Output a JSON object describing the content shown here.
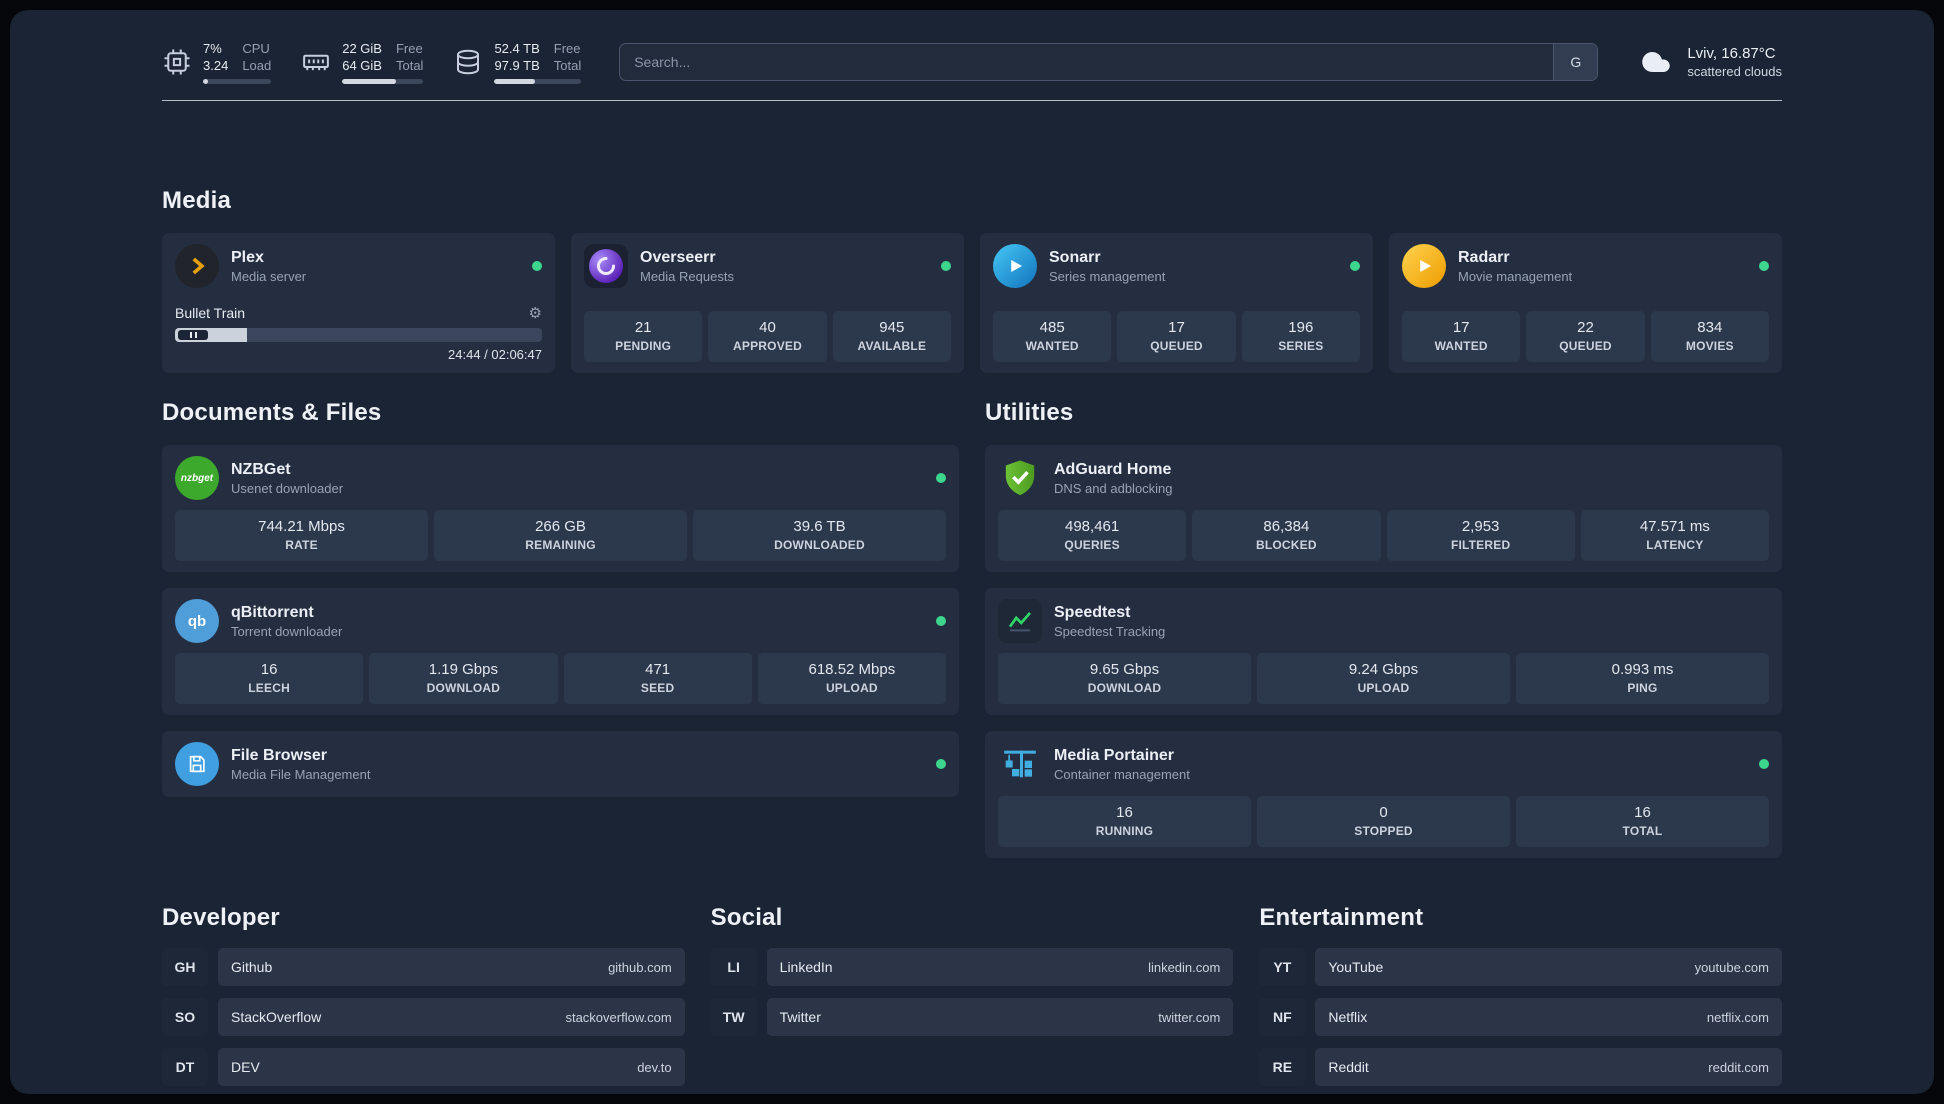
{
  "icons": {
    "gear": "⚙"
  },
  "colors": {
    "status_online": "#3dd68c",
    "accent_plex": "#e5a00d",
    "accent_sonarr": "#35c5f4",
    "accent_radarr": "#ffc230",
    "accent_overseerr": "#7c5cdb",
    "accent_nzbget": "#3ca92c",
    "accent_qbittorrent": "#4f9ed9",
    "accent_adguard": "#67b32e",
    "accent_speedtest": "#2fd566",
    "accent_portainer": "#41aee2",
    "accent_filebrowser": "#3f9fe0"
  },
  "header": {
    "cpu": {
      "value": "7%",
      "sub": "3.24",
      "label_top": "CPU",
      "label_bottom": "Load",
      "bar_percent": 7
    },
    "ram": {
      "value": "22 GiB",
      "sub": "64 GiB",
      "label_top": "Free",
      "label_bottom": "Total",
      "bar_percent": 66
    },
    "disk": {
      "value": "52.4 TB",
      "sub": "97.9 TB",
      "label_top": "Free",
      "label_bottom": "Total",
      "bar_percent": 47
    },
    "search": {
      "placeholder": "Search...",
      "engine_label": "G"
    },
    "weather": {
      "location": "Lviv, 16.87°C",
      "condition": "scattered clouds"
    }
  },
  "media": {
    "title": "Media",
    "plex": {
      "name": "Plex",
      "subtitle": "Media server",
      "now_playing": "Bullet Train",
      "time": "24:44 / 02:06:47",
      "progress_percent": 19.5
    },
    "overseerr": {
      "name": "Overseerr",
      "subtitle": "Media Requests",
      "stats": [
        {
          "value": "21",
          "label": "PENDING"
        },
        {
          "value": "40",
          "label": "APPROVED"
        },
        {
          "value": "945",
          "label": "AVAILABLE"
        }
      ]
    },
    "sonarr": {
      "name": "Sonarr",
      "subtitle": "Series management",
      "stats": [
        {
          "value": "485",
          "label": "WANTED"
        },
        {
          "value": "17",
          "label": "QUEUED"
        },
        {
          "value": "196",
          "label": "SERIES"
        }
      ]
    },
    "radarr": {
      "name": "Radarr",
      "subtitle": "Movie management",
      "stats": [
        {
          "value": "17",
          "label": "WANTED"
        },
        {
          "value": "22",
          "label": "QUEUED"
        },
        {
          "value": "834",
          "label": "MOVIES"
        }
      ]
    }
  },
  "documents": {
    "title": "Documents & Files",
    "nzbget": {
      "name": "NZBGet",
      "subtitle": "Usenet downloader",
      "icon_text": "nzbget",
      "stats": [
        {
          "value": "744.21 Mbps",
          "label": "RATE"
        },
        {
          "value": "266 GB",
          "label": "REMAINING"
        },
        {
          "value": "39.6 TB",
          "label": "DOWNLOADED"
        }
      ]
    },
    "qbittorrent": {
      "name": "qBittorrent",
      "subtitle": "Torrent downloader",
      "icon_text": "qb",
      "stats": [
        {
          "value": "16",
          "label": "LEECH"
        },
        {
          "value": "1.19 Gbps",
          "label": "DOWNLOAD"
        },
        {
          "value": "471",
          "label": "SEED"
        },
        {
          "value": "618.52 Mbps",
          "label": "UPLOAD"
        }
      ]
    },
    "filebrowser": {
      "name": "File Browser",
      "subtitle": "Media File Management"
    }
  },
  "utilities": {
    "title": "Utilities",
    "adguard": {
      "name": "AdGuard Home",
      "subtitle": "DNS and adblocking",
      "stats": [
        {
          "value": "498,461",
          "label": "QUERIES"
        },
        {
          "value": "86,384",
          "label": "BLOCKED"
        },
        {
          "value": "2,953",
          "label": "FILTERED"
        },
        {
          "value": "47.571 ms",
          "label": "LATENCY"
        }
      ]
    },
    "speedtest": {
      "name": "Speedtest",
      "subtitle": "Speedtest Tracking",
      "stats": [
        {
          "value": "9.65 Gbps",
          "label": "DOWNLOAD"
        },
        {
          "value": "9.24 Gbps",
          "label": "UPLOAD"
        },
        {
          "value": "0.993 ms",
          "label": "PING"
        }
      ]
    },
    "portainer": {
      "name": "Media Portainer",
      "subtitle": "Container management",
      "stats": [
        {
          "value": "16",
          "label": "RUNNING"
        },
        {
          "value": "0",
          "label": "STOPPED"
        },
        {
          "value": "16",
          "label": "TOTAL"
        }
      ]
    }
  },
  "bookmarks": {
    "developer": {
      "title": "Developer",
      "links": [
        {
          "abbr": "GH",
          "name": "Github",
          "url": "github.com"
        },
        {
          "abbr": "SO",
          "name": "StackOverflow",
          "url": "stackoverflow.com"
        },
        {
          "abbr": "DT",
          "name": "DEV",
          "url": "dev.to"
        }
      ]
    },
    "social": {
      "title": "Social",
      "links": [
        {
          "abbr": "LI",
          "name": "LinkedIn",
          "url": "linkedin.com"
        },
        {
          "abbr": "TW",
          "name": "Twitter",
          "url": "twitter.com"
        }
      ]
    },
    "entertainment": {
      "title": "Entertainment",
      "links": [
        {
          "abbr": "YT",
          "name": "YouTube",
          "url": "youtube.com"
        },
        {
          "abbr": "NF",
          "name": "Netflix",
          "url": "netflix.com"
        },
        {
          "abbr": "RE",
          "name": "Reddit",
          "url": "reddit.com"
        }
      ]
    }
  }
}
